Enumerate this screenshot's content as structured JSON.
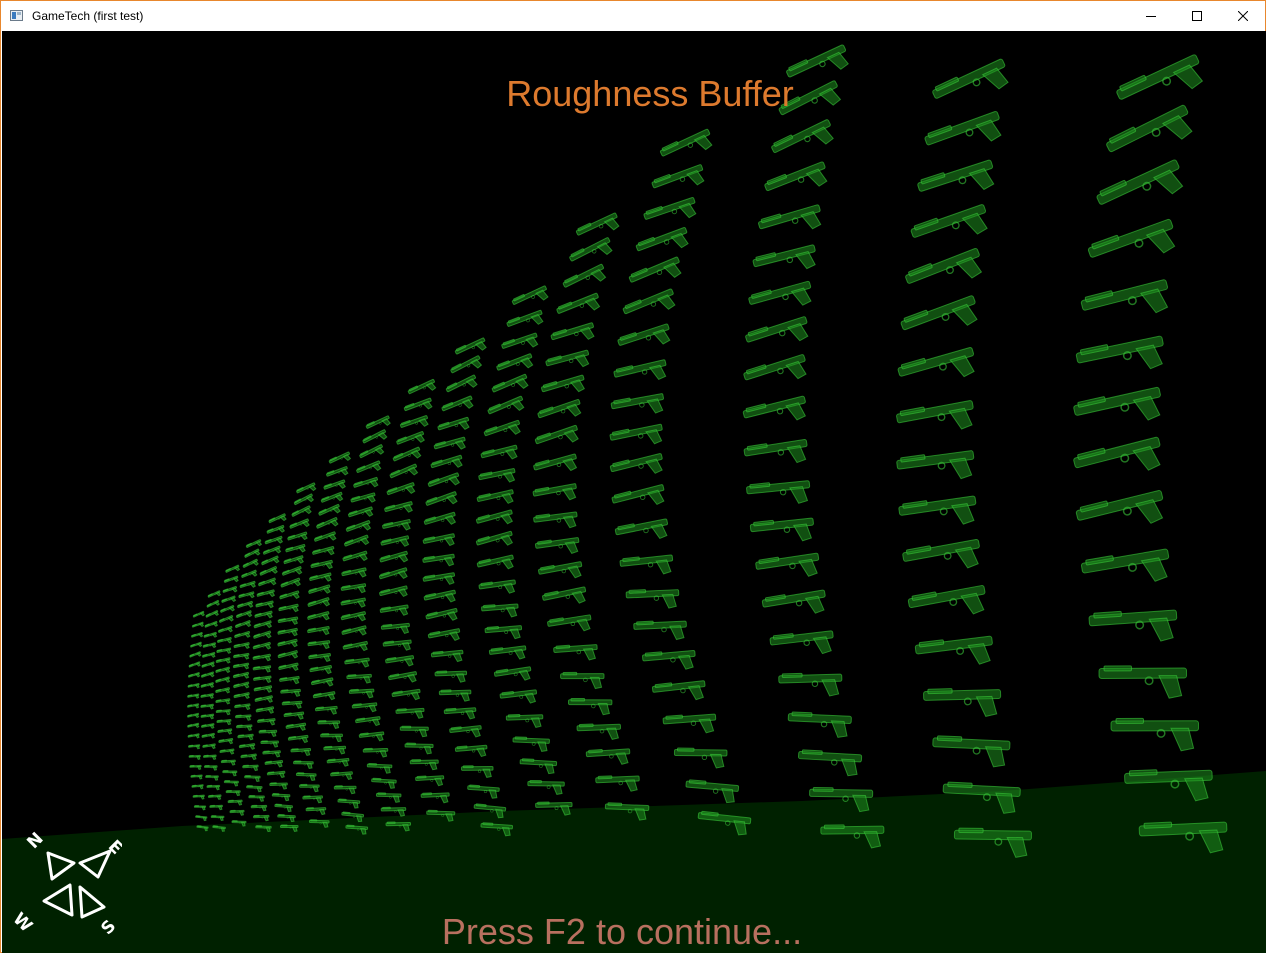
{
  "window": {
    "title": "GameTech (first test)",
    "controls": {
      "minimize": "minimize",
      "maximize": "maximize",
      "close": "close"
    }
  },
  "viewport": {
    "buffer_title": "Roughness Buffer",
    "prompt": "Press F2 to continue...",
    "compass": {
      "north": "N",
      "east": "E",
      "south": "S",
      "west": "W"
    }
  },
  "colors": {
    "title_text": "#dd7a2e",
    "prompt_text": "#b8705f",
    "ground": "#002100",
    "models": "#1f8f1f",
    "background": "#000000",
    "window_border": "#e8872d"
  }
}
